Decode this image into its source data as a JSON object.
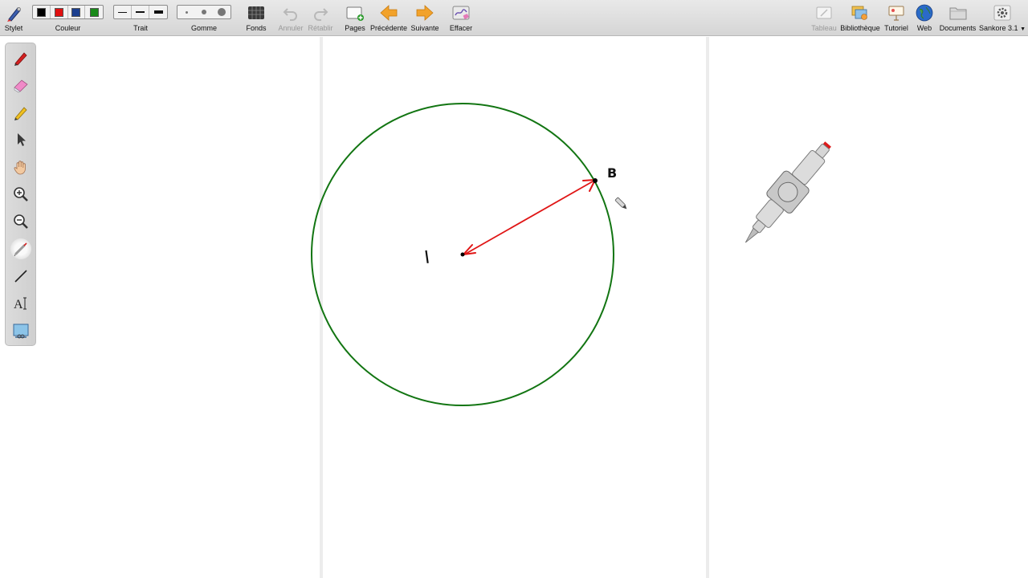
{
  "toolbar": {
    "stylet": "Stylet",
    "couleur": "Couleur",
    "trait": "Trait",
    "gomme": "Gomme",
    "fonds": "Fonds",
    "annuler": "Annuler",
    "retablir": "Rétablir",
    "pages": "Pages",
    "precedente": "Précédente",
    "suivante": "Suivante",
    "effacer": "Effacer",
    "tableau": "Tableau",
    "bibliotheque": "Bibliothèque",
    "tutoriel": "Tutoriel",
    "web": "Web",
    "documents": "Documents",
    "sankore": "Sankore 3.1"
  },
  "colors": {
    "swatches": [
      "#000000",
      "#e01010",
      "#1c3f8f",
      "#1a8a1a"
    ],
    "circle": "#127512",
    "arrow": "#e01515"
  },
  "palette": {
    "tools": [
      {
        "name": "pen-tool-icon",
        "active": false
      },
      {
        "name": "eraser-tool-icon",
        "active": false
      },
      {
        "name": "highlighter-tool-icon",
        "active": false
      },
      {
        "name": "select-tool-icon",
        "active": false
      },
      {
        "name": "hand-tool-icon",
        "active": false
      },
      {
        "name": "zoom-in-tool-icon",
        "active": false
      },
      {
        "name": "zoom-out-tool-icon",
        "active": false
      },
      {
        "name": "laser-pointer-tool-icon",
        "active": true
      },
      {
        "name": "line-tool-icon",
        "active": false
      },
      {
        "name": "text-tool-icon",
        "active": false
      },
      {
        "name": "capture-tool-icon",
        "active": false
      }
    ],
    "text_tool_glyph": "A"
  },
  "board": {
    "label_center": "I",
    "label_point": "B"
  }
}
